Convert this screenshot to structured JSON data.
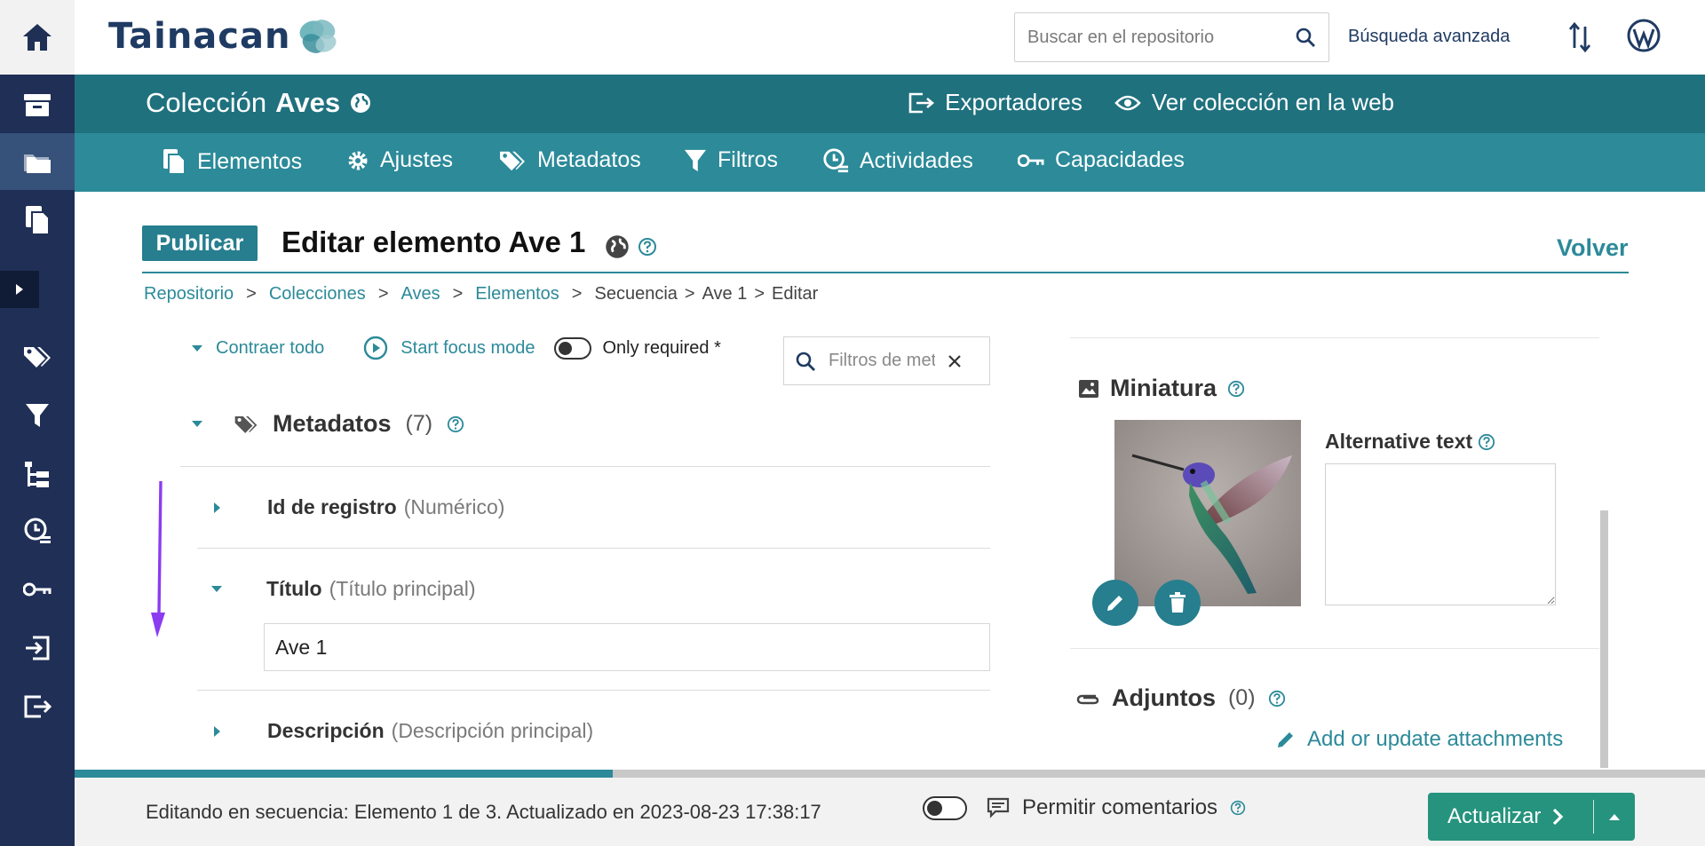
{
  "header": {
    "logo_text": "Tainacan",
    "search_placeholder": "Buscar en el repositorio",
    "advanced_search": "Búsqueda avanzada"
  },
  "collection": {
    "prefix": "Colección",
    "name": "Aves",
    "exporters": "Exportadores",
    "view_web": "Ver colección en la web",
    "nav": [
      "Elementos",
      "Ajustes",
      "Metadatos",
      "Filtros",
      "Actividades",
      "Capacidades"
    ]
  },
  "page": {
    "status_badge": "Publicar",
    "title": "Editar elemento Ave 1",
    "back": "Volver",
    "breadcrumb": [
      "Repositorio",
      "Colecciones",
      "Aves",
      "Elementos",
      "Secuencia",
      "Ave 1",
      "Editar"
    ]
  },
  "form": {
    "collapse_all": "Contraer todo",
    "focus_mode": "Start focus mode",
    "only_required": "Only required *",
    "filter_placeholder": "Filtros de metadatos",
    "section_title": "Metadatos",
    "section_count": "(7)",
    "fields": [
      {
        "label": "Id de registro",
        "type": "(Numérico)"
      },
      {
        "label": "Título",
        "type": "(Título principal)",
        "value": "Ave 1"
      },
      {
        "label": "Descripción",
        "type": "(Descripción principal)"
      }
    ]
  },
  "side": {
    "thumbnail_title": "Miniatura",
    "alt_text_label": "Alternative text",
    "attachments_title": "Adjuntos",
    "attachments_count": "(0)",
    "attach_link": "Add or update attachments"
  },
  "footer": {
    "status": "Editando en secuencia: Elemento 1 de 3. Actualizado en 2023-08-23 17:38:17",
    "comments": "Permitir comentarios",
    "update": "Actualizar",
    "sequence_progress": 0.33
  },
  "colors": {
    "sidebar": "#1f2f56",
    "collection_header": "#1f717e",
    "collection_nav": "#2c8a99",
    "accent": "#2c8a99",
    "update_button": "#25937d",
    "arrow": "#8b3cf0"
  }
}
